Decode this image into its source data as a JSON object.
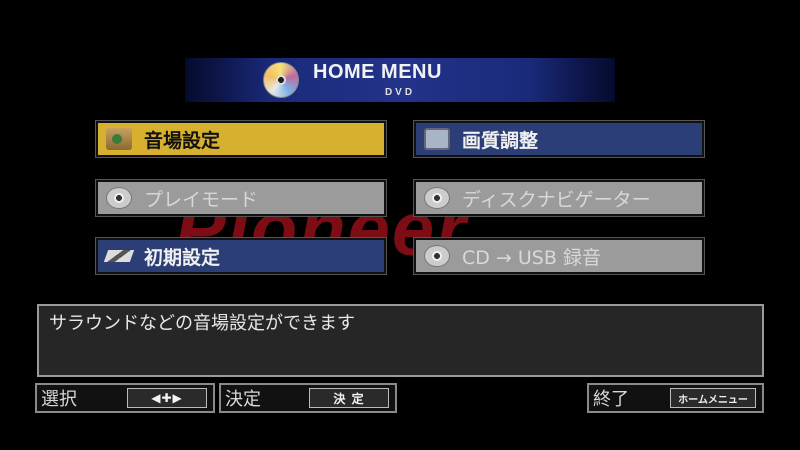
{
  "header": {
    "title": "HOME MENU",
    "subtitle": "DVD"
  },
  "brand": {
    "text": "Pioneer",
    "color": "#8a0f18"
  },
  "menu": {
    "items": [
      {
        "label": "音場設定",
        "state": "selected",
        "icon": "speaker-icon"
      },
      {
        "label": "画質調整",
        "state": "active",
        "icon": "tv-icon"
      },
      {
        "label": "プレイモード",
        "state": "disabled",
        "icon": "disc-icon"
      },
      {
        "label": "ディスクナビゲーター",
        "state": "disabled",
        "icon": "disc-icon"
      },
      {
        "label": "初期設定",
        "state": "active",
        "icon": "wrench-icon"
      },
      {
        "label": "CD → USB 録音",
        "state": "disabled",
        "icon": "disc-icon"
      }
    ]
  },
  "info": {
    "text": "サラウンドなどの音場設定ができます"
  },
  "footer": {
    "select_label": "選択",
    "select_key": "◀✚▶",
    "enter_label": "決定",
    "enter_key": "決 定",
    "exit_label": "終了",
    "exit_key": "ホームメニュー"
  },
  "colors": {
    "selected": "#d6b02e",
    "active": "#2c3e76",
    "disabled": "#9b9b9b"
  }
}
